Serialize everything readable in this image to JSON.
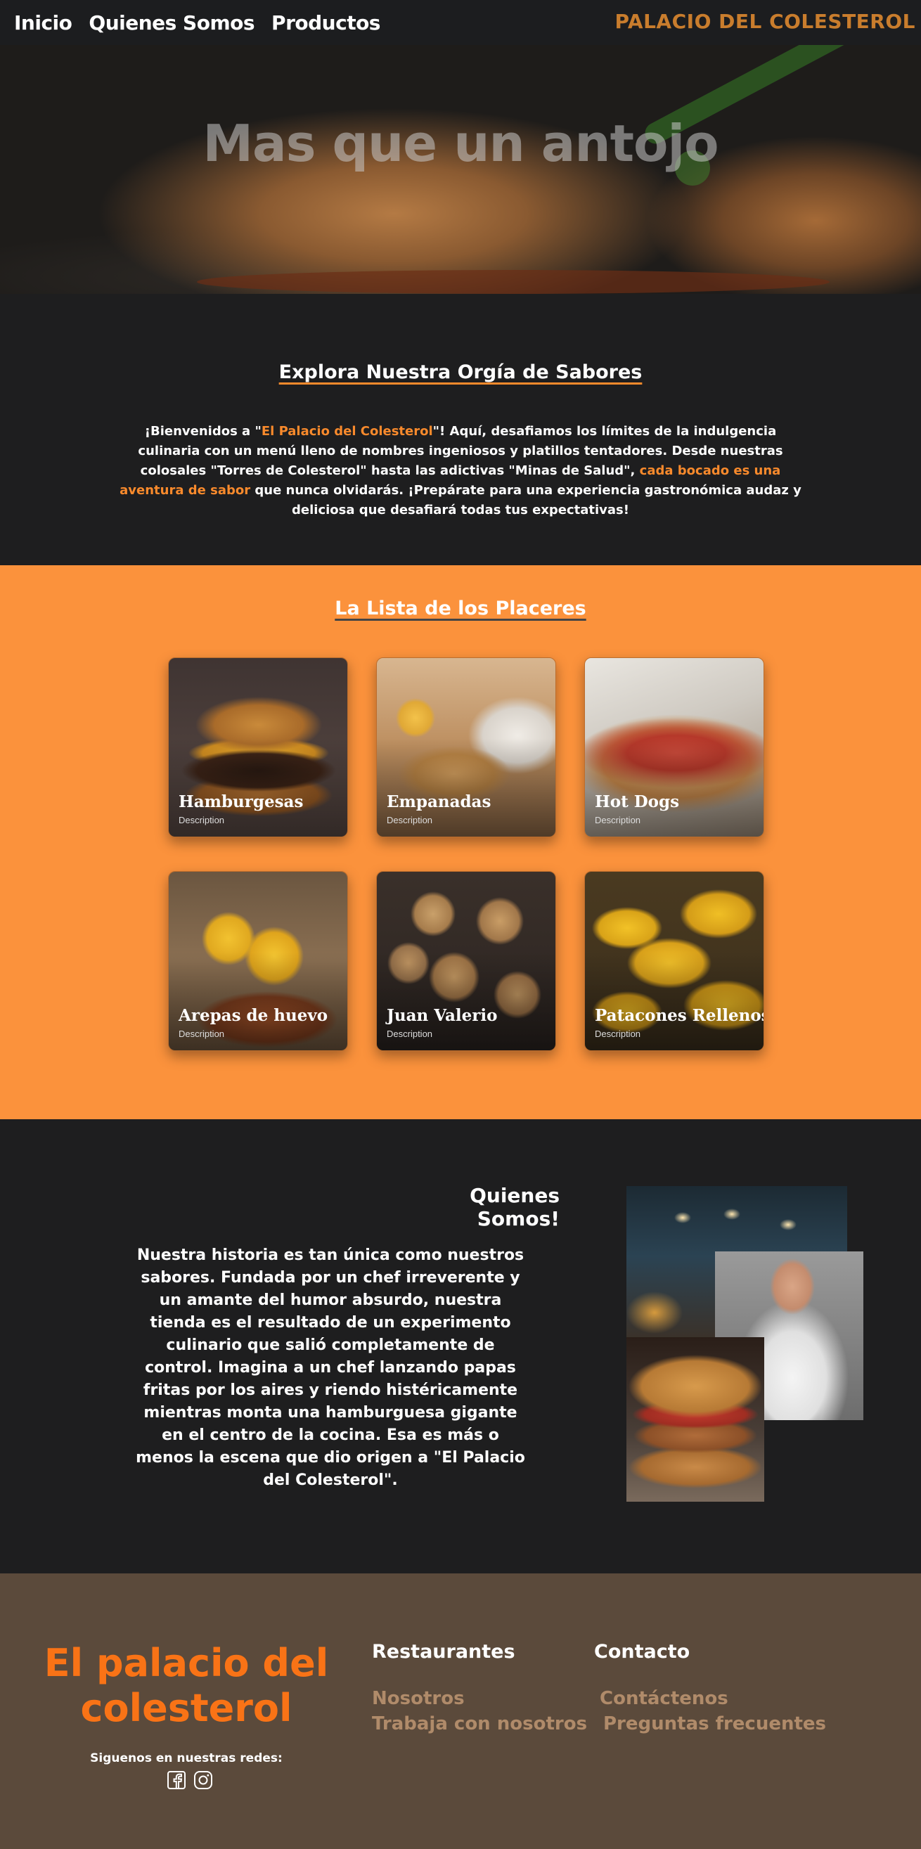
{
  "nav": {
    "links": [
      "Inicio",
      "Quienes Somos",
      "Productos"
    ],
    "brand": "PALACIO DEL COLESTEROL"
  },
  "hero": {
    "title": "Mas que un antojo"
  },
  "explora": {
    "title": "Explora Nuestra Orgía de Sabores",
    "text_1": "¡Bienvenidos a \"",
    "highlight_1": "El Palacio del Colesterol",
    "text_2": "\"! Aquí, desafiamos los límites de la indulgencia culinaria con un menú lleno de nombres ingeniosos y platillos tentadores. Desde nuestras colosales \"Torres de Colesterol\" hasta las adictivas \"Minas de Salud\", ",
    "highlight_2": "cada bocado es una aventura de sabor",
    "text_3": " que nunca olvidarás. ¡Prepárate para una experiencia gastronómica audaz y deliciosa que desafiará todas tus expectativas!"
  },
  "lista": {
    "title": "La Lista de los Placeres",
    "cards": [
      {
        "title": "Hamburgesas",
        "desc": "Description"
      },
      {
        "title": "Empanadas",
        "desc": "Description"
      },
      {
        "title": "Hot Dogs",
        "desc": "Description"
      },
      {
        "title": "Arepas de huevo",
        "desc": "Description"
      },
      {
        "title": "Juan Valerio",
        "desc": "Description"
      },
      {
        "title": "Patacones Rellenos",
        "desc": "Description"
      }
    ]
  },
  "quienes": {
    "title": "Quienes Somos!",
    "text": "Nuestra historia es tan única como nuestros sabores. Fundada por un chef irreverente y un amante del humor absurdo, nuestra tienda es el resultado de un experimento culinario que salió completamente de control. Imagina a un chef lanzando papas fritas por los aires y riendo histéricamente mientras monta una hamburguesa gigante en el centro de la cocina. Esa es más o menos la escena que dio origen a \"El Palacio del Colesterol\"."
  },
  "footer": {
    "brand": "El palacio del colesterol",
    "social_label": "Siguenos en nuestras redes:",
    "col1": {
      "title": "Restaurantes",
      "links": [
        "Nosotros",
        "Trabaja con nosotros"
      ]
    },
    "col2": {
      "title": "Contacto",
      "links": [
        "Contáctenos",
        "Preguntas frecuentes"
      ]
    }
  },
  "colors": {
    "accent": "#f98a2c",
    "section_orange": "#fb923c",
    "dark_bg": "#1e1e1f",
    "footer_bg": "#5b4a3b",
    "footer_link": "#b08b6a",
    "brand_gold": "#c97d2d"
  },
  "icons": [
    "facebook-icon",
    "instagram-icon"
  ]
}
